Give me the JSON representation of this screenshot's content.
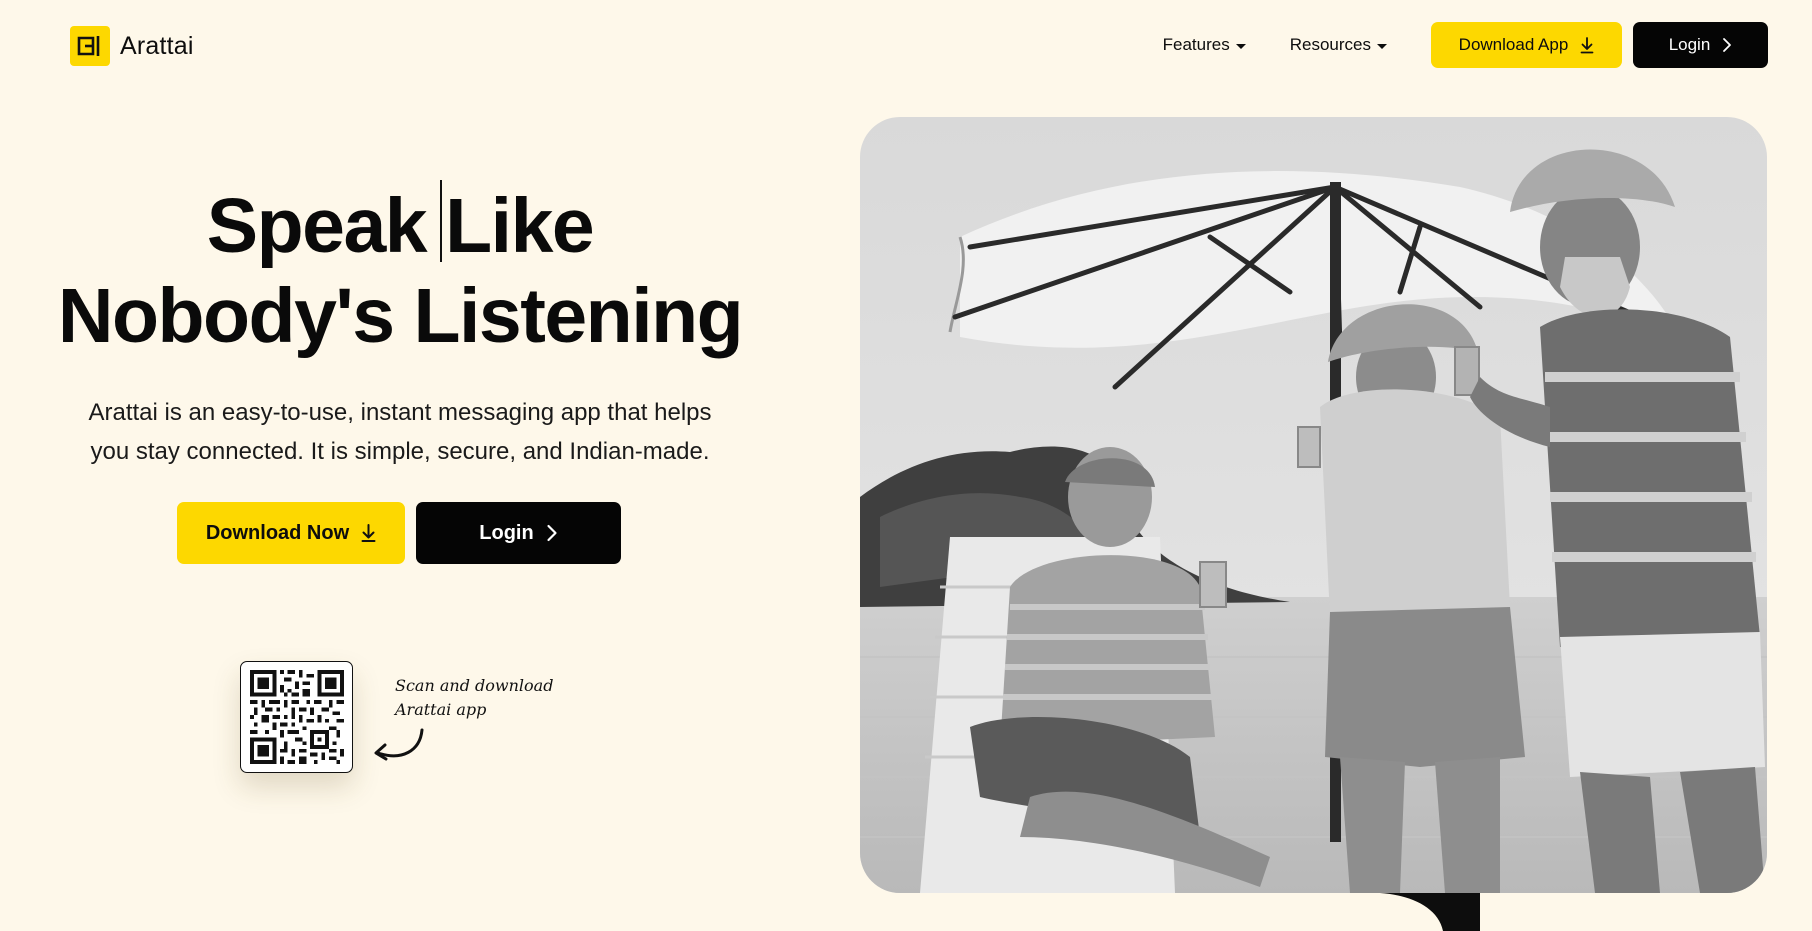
{
  "header": {
    "brand": "Arattai",
    "nav": [
      {
        "label": "Features"
      },
      {
        "label": "Resources"
      }
    ],
    "download_app_label": "Download App",
    "login_label": "Login"
  },
  "hero": {
    "headline_line1_a": "Speak",
    "headline_line1_b": "Like",
    "headline_line2": "Nobody's Listening",
    "tagline_line1": "Arattai is an easy-to-use, instant messaging app that helps",
    "tagline_line2": "you stay connected. It is simple, secure, and Indian-made.",
    "download_now_label": "Download Now",
    "login_label": "Login",
    "qr_caption": "Scan and download\nArattai app"
  },
  "colors": {
    "background": "#fef8ea",
    "accent_yellow": "#fdd800",
    "button_black": "#050505"
  },
  "icons": {
    "logo": "arattai-logo-icon",
    "download": "download-arrow-icon",
    "chevron": "chevron-right-icon",
    "caret": "caret-down-icon",
    "qr": "qr-code",
    "curly_arrow": "curly-arrow-icon"
  }
}
